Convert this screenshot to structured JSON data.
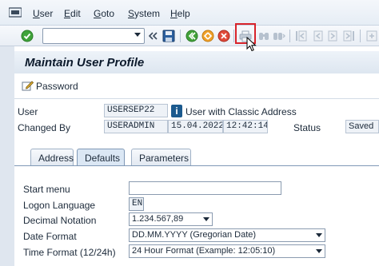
{
  "menu": {
    "items": [
      {
        "label": "User",
        "accel": "U",
        "rest": "ser"
      },
      {
        "label": "Edit",
        "accel": "E",
        "rest": "dit"
      },
      {
        "label": "Goto",
        "accel": "G",
        "rest": "oto"
      },
      {
        "label": "System",
        "accel": "S",
        "rest": "ystem"
      },
      {
        "label": "Help",
        "accel": "H",
        "rest": "elp"
      }
    ]
  },
  "toolbar": {
    "command_value": "",
    "icons": [
      "enter-check-icon",
      "save-icon",
      "back-icon",
      "exit-icon",
      "cancel-icon",
      "print-icon",
      "find-icon",
      "find-next-icon",
      "first-page-icon",
      "previous-page-icon",
      "next-page-icon",
      "last-page-icon"
    ]
  },
  "title": "Maintain User Profile",
  "password_button": "Password",
  "header": {
    "user_label": "User",
    "user_value": "USERSEP22",
    "user_type": "User with Classic Address",
    "changed_by_label": "Changed By",
    "changed_by_value": "USERADMIN",
    "changed_date": "15.04.2022",
    "changed_time": "12:42:14",
    "status_label": "Status",
    "status_value": "Saved"
  },
  "tabs": [
    {
      "label": "Address",
      "active": false
    },
    {
      "label": "Defaults",
      "active": true
    },
    {
      "label": "Parameters",
      "active": false
    }
  ],
  "defaults": {
    "start_menu_label": "Start menu",
    "start_menu_value": "",
    "logon_language_label": "Logon Language",
    "logon_language_value": "EN",
    "decimal_label": "Decimal Notation",
    "decimal_value": "1.234.567,89",
    "date_format_label": "Date Format",
    "date_format_value": "DD.MM.YYYY (Gregorian Date)",
    "time_format_label": "Time Format (12/24h)",
    "time_format_value": "24 Hour Format (Example: 12:05:10)"
  },
  "colors": {
    "highlight": "#d8232a",
    "accent": "#1c5a8e"
  }
}
